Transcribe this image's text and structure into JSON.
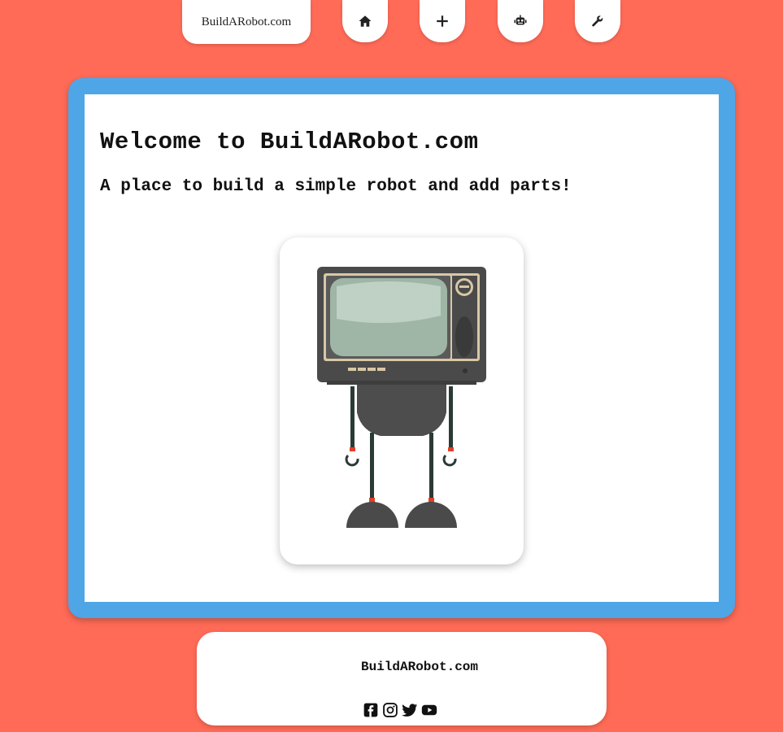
{
  "nav": {
    "brand": "BuildARobot.com",
    "buttons": [
      {
        "icon": "home-icon",
        "name": "home-button"
      },
      {
        "icon": "plus-icon",
        "name": "add-button"
      },
      {
        "icon": "robot-icon",
        "name": "robots-button"
      },
      {
        "icon": "wrench-icon",
        "name": "parts-button"
      }
    ]
  },
  "main": {
    "title": "Welcome to BuildARobot.com",
    "subtitle": "A place to build a simple robot and add parts!"
  },
  "footer": {
    "brand": "BuildARobot.com",
    "socials": [
      "facebook-icon",
      "instagram-icon",
      "twitter-icon",
      "youtube-icon"
    ]
  },
  "colors": {
    "background": "#ff6b57",
    "frame": "#4fa6e6",
    "panel": "#ffffff"
  }
}
